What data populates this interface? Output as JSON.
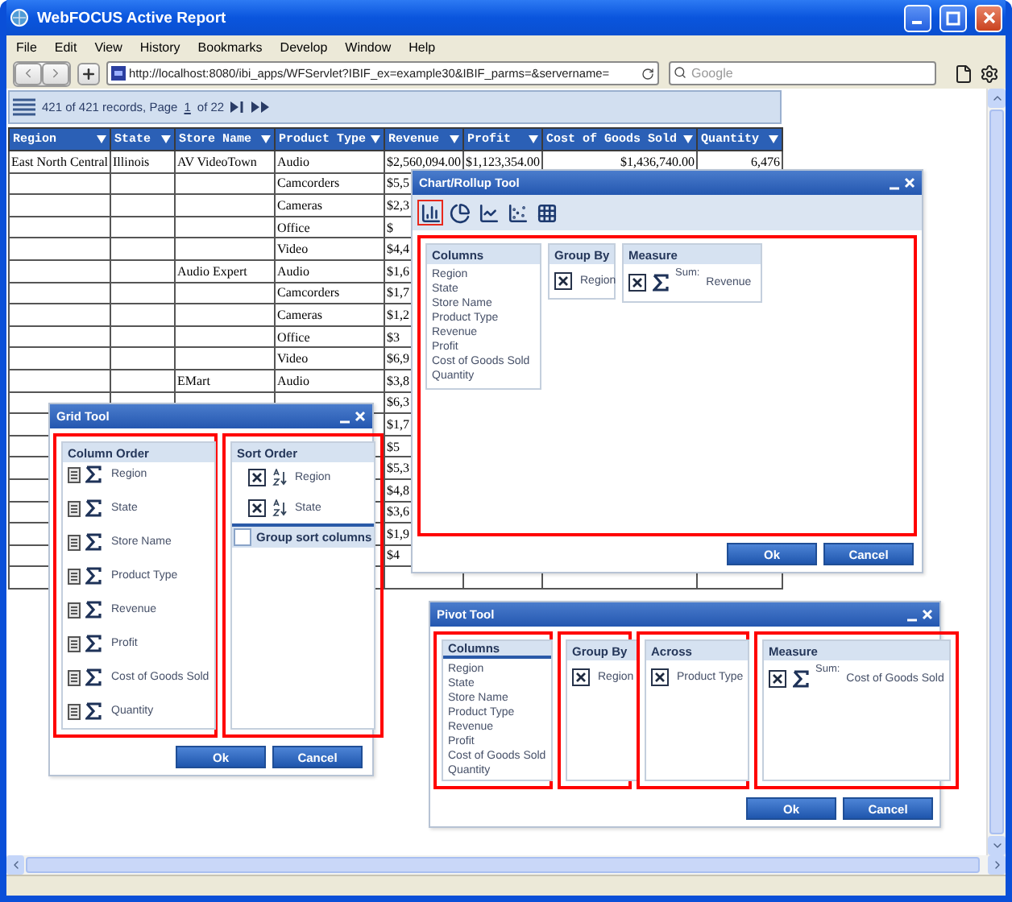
{
  "window": {
    "title": "WebFOCUS Active Report"
  },
  "menu": [
    "File",
    "Edit",
    "View",
    "History",
    "Bookmarks",
    "Develop",
    "Window",
    "Help"
  ],
  "address_bar": {
    "url": "http://localhost:8080/ibi_apps/WFServlet?IBIF_ex=example30&IBIF_parms=&servername="
  },
  "search": {
    "placeholder": "Google"
  },
  "report": {
    "records": "421 of 421 records, Page",
    "page": "1",
    "page_count": "of 22",
    "columns": [
      "Region",
      "State",
      "Store Name",
      "Product Type",
      "Revenue",
      "Profit",
      "Cost of Goods Sold",
      "Quantity"
    ],
    "rows": [
      {
        "region": "East North Central",
        "state": "Illinois",
        "store_name": "AV VideoTown",
        "product_type": "Audio",
        "revenue": "$2,560,094.00",
        "profit": "$1,123,354.00",
        "cost_of_goods_sold": "$1,436,740.00",
        "quantity": "6,476"
      },
      {
        "product_type": "Camcorders",
        "revenue": "$5,5"
      },
      {
        "product_type": "Cameras",
        "revenue": "$2,3"
      },
      {
        "product_type": "Office",
        "revenue": "$"
      },
      {
        "product_type": "Video",
        "revenue": "$4,4"
      },
      {
        "store_name": "Audio Expert",
        "product_type": "Audio",
        "revenue": "$1,6"
      },
      {
        "product_type": "Camcorders",
        "revenue": "$1,7"
      },
      {
        "product_type": "Cameras",
        "revenue": "$1,2"
      },
      {
        "product_type": "Office",
        "revenue": "$3"
      },
      {
        "product_type": "Video",
        "revenue": "$6,9"
      },
      {
        "store_name": "EMart",
        "product_type": "Audio",
        "revenue": "$3,8"
      },
      {
        "revenue": "$6,3"
      },
      {
        "revenue": "$1,7"
      },
      {
        "revenue": "$5"
      },
      {
        "revenue": "$5,3"
      },
      {
        "revenue": "$4,8"
      },
      {
        "revenue": "$3,6"
      },
      {
        "revenue": "$1,9"
      },
      {
        "revenue": "$4"
      },
      {}
    ]
  },
  "chart_tool": {
    "title": "Chart/Rollup Tool",
    "chart_types": [
      {
        "kind": "bar",
        "selected": true
      },
      {
        "kind": "pie",
        "selected": false
      },
      {
        "kind": "line",
        "selected": false
      },
      {
        "kind": "scatter",
        "selected": false
      },
      {
        "kind": "grid",
        "selected": false
      }
    ],
    "columns": {
      "heading": "Columns",
      "items": [
        "Region",
        "State",
        "Store Name",
        "Product Type",
        "Revenue",
        "Profit",
        "Cost of Goods Sold",
        "Quantity"
      ]
    },
    "group_by": {
      "heading": "Group By",
      "items": [
        "Region"
      ]
    },
    "measure": {
      "heading": "Measure",
      "items": [
        {
          "function": "Sum:",
          "label": "Revenue"
        }
      ]
    },
    "buttons": [
      "Ok",
      "Cancel"
    ]
  },
  "grid_tool": {
    "title": "Grid Tool",
    "column_order": {
      "heading": "Column Order",
      "items": [
        "Region",
        "State",
        "Store Name",
        "Product Type",
        "Revenue",
        "Profit",
        "Cost of Goods Sold",
        "Quantity"
      ]
    },
    "sort_order": {
      "heading": "Sort Order",
      "items": [
        "Region",
        "State"
      ]
    },
    "group_sort_columns": {
      "label": "Group sort columns",
      "checked": false
    },
    "buttons": [
      "Ok",
      "Cancel"
    ]
  },
  "pivot_tool": {
    "title": "Pivot Tool",
    "columns": {
      "heading": "Columns",
      "items": [
        "Region",
        "State",
        "Store Name",
        "Product Type",
        "Revenue",
        "Profit",
        "Cost of Goods Sold",
        "Quantity"
      ]
    },
    "group_by": {
      "heading": "Group By",
      "items": [
        "Region"
      ]
    },
    "across": {
      "heading": "Across",
      "items": [
        "Product Type"
      ]
    },
    "measure": {
      "heading": "Measure",
      "items": [
        {
          "function": "Sum:",
          "label": "Cost of Goods Sold"
        }
      ]
    },
    "buttons": [
      "Ok",
      "Cancel"
    ]
  }
}
